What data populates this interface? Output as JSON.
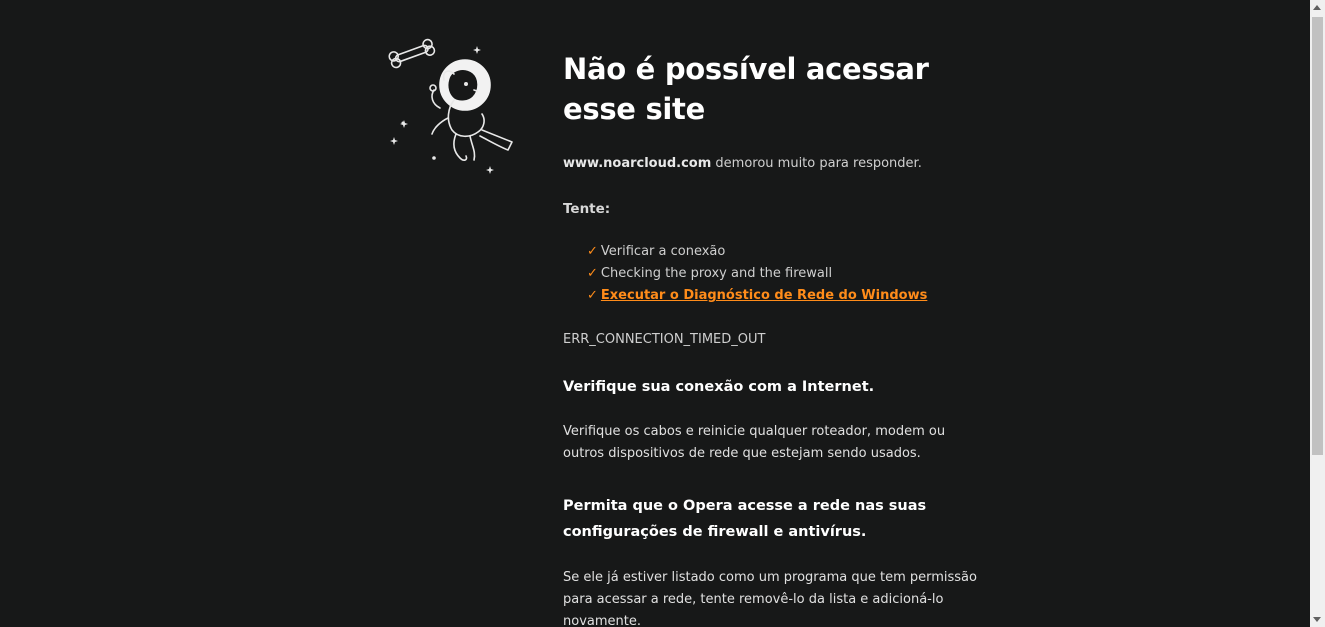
{
  "error_page": {
    "title": "Não é possível acessar esse site",
    "host": "www.noarcloud.com",
    "description_suffix": " demorou muito para responder.",
    "try_label": "Tente:",
    "suggestions": [
      {
        "label": "Verificar a conexão",
        "link": false
      },
      {
        "label": "Checking the proxy and the firewall",
        "link": false
      },
      {
        "label": "Executar o Diagnóstico de Rede do Windows",
        "link": true
      }
    ],
    "check_glyph": "✓",
    "error_code": "ERR_CONNECTION_TIMED_OUT",
    "section1": {
      "heading": "Verifique sua conexão com a Internet.",
      "body": "Verifique os cabos e reinicie qualquer roteador, modem ou outros dispositivos de rede que estejam sendo usados."
    },
    "section2": {
      "heading": "Permita que o Opera acesse a rede nas suas configurações de firewall e antivírus.",
      "body": "Se ele já estiver listado como um programa que tem permissão para acessar a rede, tente removê-lo da lista e adicioná-lo novamente."
    }
  },
  "colors": {
    "background": "#171818",
    "accent": "#ff8c1a",
    "text": "#e6e6e6"
  },
  "icons": {
    "illustration": "space-dog-illustration",
    "check": "check-icon"
  }
}
